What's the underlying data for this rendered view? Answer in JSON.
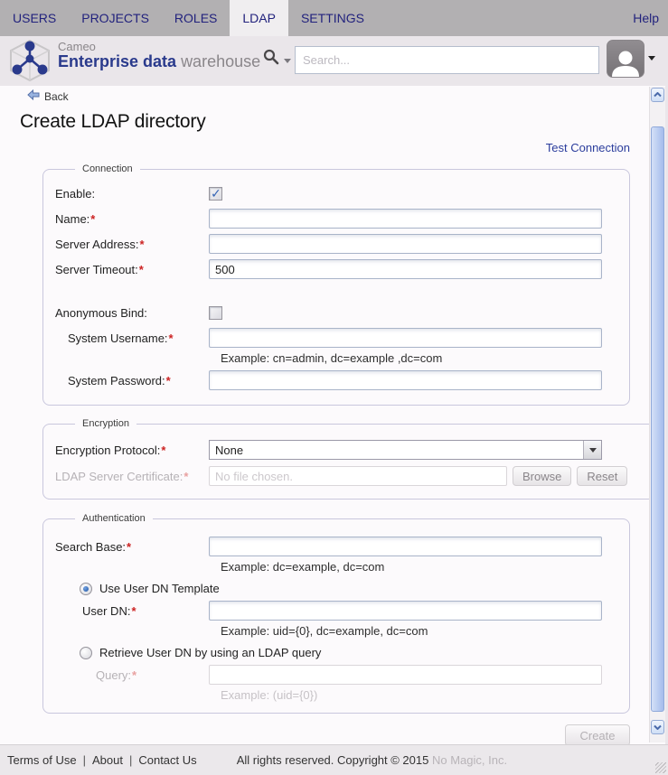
{
  "nav": {
    "items": [
      {
        "label": "USERS",
        "active": false
      },
      {
        "label": "PROJECTS",
        "active": false
      },
      {
        "label": "ROLES",
        "active": false
      },
      {
        "label": "LDAP",
        "active": true
      },
      {
        "label": "SETTINGS",
        "active": false
      }
    ],
    "help_label": "Help"
  },
  "header": {
    "brand_top": "Cameo",
    "brand_main_strong": "Enterprise data",
    "brand_main_light": "warehouse",
    "search_placeholder": "Search..."
  },
  "page": {
    "back_label": "Back",
    "title": "Create LDAP directory",
    "test_connection_label": "Test Connection"
  },
  "misc": {
    "required_marker": "*"
  },
  "connection": {
    "legend": "Connection",
    "enable_label": "Enable:",
    "enable_checked": true,
    "name_label": "Name:",
    "name_value": "",
    "server_address_label": "Server Address:",
    "server_address_value": "",
    "server_timeout_label": "Server Timeout:",
    "server_timeout_value": "500",
    "anonymous_bind_label": "Anonymous Bind:",
    "anonymous_bind_checked": false,
    "system_username_label": "System Username:",
    "system_username_value": "",
    "system_username_hint": "Example: cn=admin, dc=example ,dc=com",
    "system_password_label": "System Password:",
    "system_password_value": ""
  },
  "encryption": {
    "legend": "Encryption",
    "protocol_label": "Encryption Protocol:",
    "protocol_value": "None",
    "certificate_label": "LDAP Server Certificate:",
    "certificate_placeholder": "No file chosen.",
    "certificate_disabled": true,
    "browse_label": "Browse",
    "reset_label": "Reset"
  },
  "authentication": {
    "legend": "Authentication",
    "search_base_label": "Search Base:",
    "search_base_value": "",
    "search_base_hint": "Example: dc=example, dc=com",
    "dn_template_radio_label": "Use User DN Template",
    "dn_template_selected": true,
    "user_dn_label": "User DN:",
    "user_dn_value": "",
    "user_dn_hint": "Example: uid={0}, dc=example, dc=com",
    "ldap_query_radio_label": "Retrieve User DN by using an LDAP query",
    "ldap_query_selected": false,
    "query_label": "Query:",
    "query_value": "",
    "query_disabled": true,
    "query_hint": "Example: (uid={0})"
  },
  "actions": {
    "create_label": "Create"
  },
  "footer": {
    "links": [
      "Terms of Use",
      "About",
      "Contact Us"
    ],
    "copyright_text": "All rights reserved. Copyright © 2015",
    "company": "No Magic, Inc."
  },
  "colors": {
    "nav_bg": "#b2b0b2",
    "nav_text": "#22227d",
    "active_tab_bg": "#f0eef0",
    "header_bg": "#eae6ea",
    "brand_navy": "#2a3a8c",
    "brand_gray": "#8a868a",
    "link_blue": "#2a3c9c",
    "required_red": "#cc2222",
    "input_border": "#a9b4c9",
    "fieldset_border": "#c9c7dd",
    "disabled_text": "#b6b2b6",
    "footer_bg": "#ebe8eb"
  }
}
